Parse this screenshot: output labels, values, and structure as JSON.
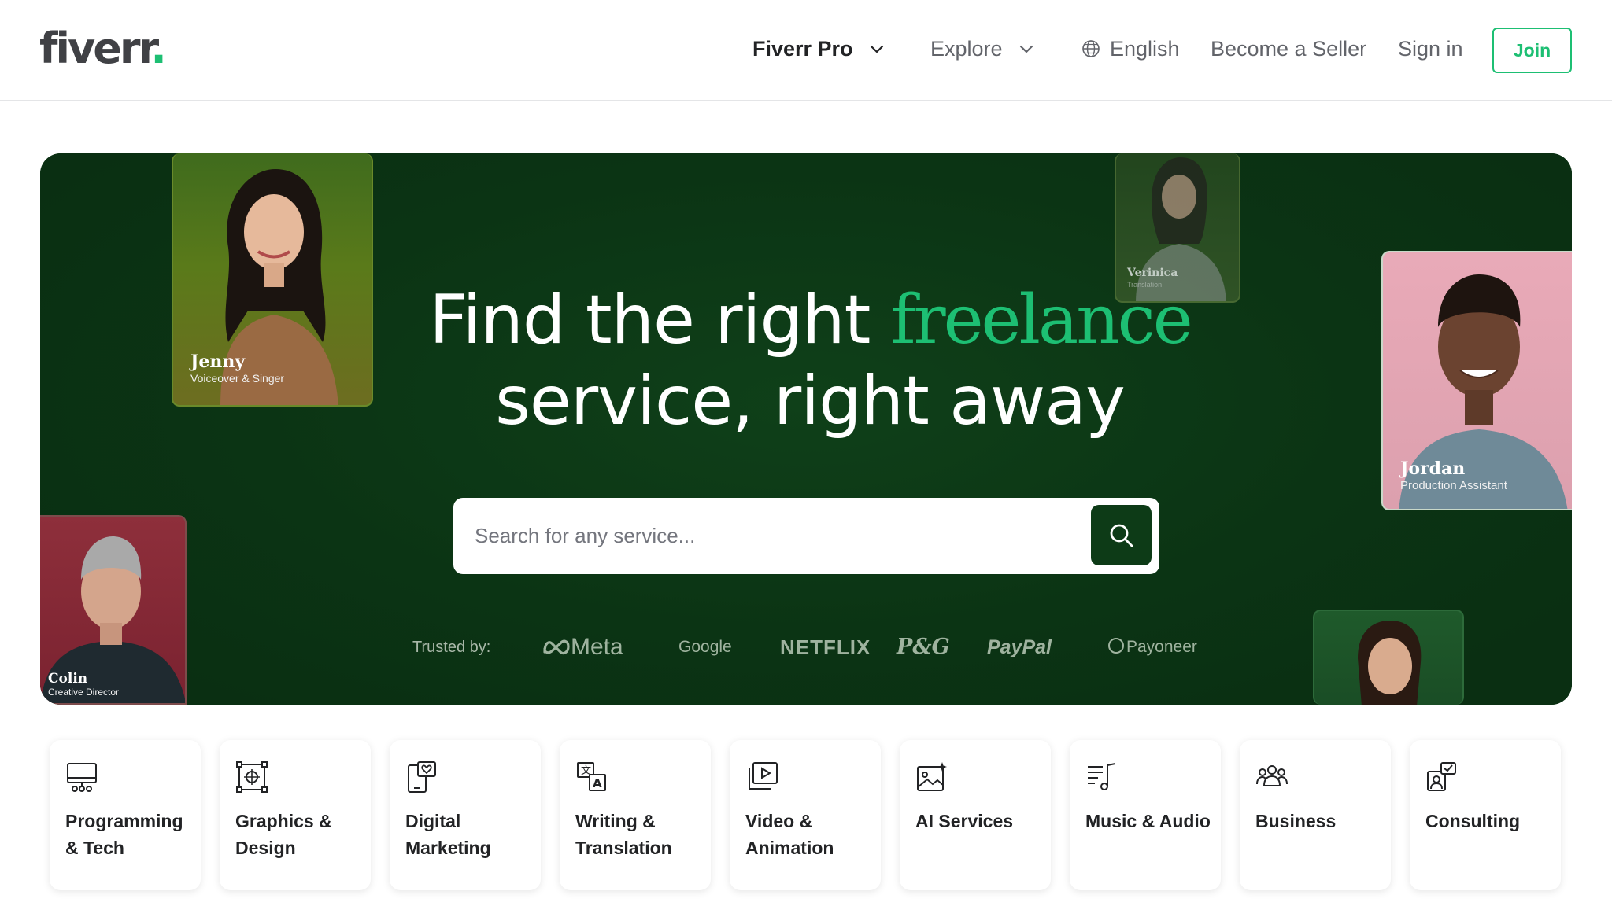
{
  "header": {
    "logo": {
      "text": "fiverr",
      "dot": "."
    },
    "nav": {
      "fiverr_pro": "Fiverr Pro",
      "explore": "Explore",
      "language": "English",
      "become_seller": "Become a Seller",
      "sign_in": "Sign in",
      "join": "Join"
    }
  },
  "hero": {
    "title_line1_pre": "Find the right ",
    "title_accent": "freelance",
    "title_line2": "service, right away",
    "search": {
      "placeholder": "Search for any service..."
    },
    "trusted_label": "Trusted by:",
    "brands": [
      "Meta",
      "Google",
      "NETFLIX",
      "P&G",
      "PayPal",
      "Payoneer"
    ],
    "cards": [
      {
        "name": "Jenny",
        "role": "Voiceover & Singer"
      },
      {
        "name": "Verinica",
        "role": "Translation"
      },
      {
        "name": "Jordan",
        "role": "Production Assistant"
      },
      {
        "name": "Colin",
        "role": "Creative Director"
      }
    ]
  },
  "categories": [
    {
      "label": "Programming & Tech",
      "icon": "monitor-code-icon"
    },
    {
      "label": "Graphics & Design",
      "icon": "design-frame-icon"
    },
    {
      "label": "Digital Marketing",
      "icon": "phone-heart-icon"
    },
    {
      "label": "Writing & Translation",
      "icon": "translate-icon"
    },
    {
      "label": "Video & Animation",
      "icon": "video-play-icon"
    },
    {
      "label": "AI Services",
      "icon": "ai-image-icon"
    },
    {
      "label": "Music & Audio",
      "icon": "music-note-icon"
    },
    {
      "label": "Business",
      "icon": "people-group-icon"
    },
    {
      "label": "Consulting",
      "icon": "consulting-chat-icon"
    }
  ],
  "colors": {
    "brand_green": "#1dbf73",
    "hero_bg": "#0d3b17",
    "text_dark": "#222325",
    "text_muted": "#62646a"
  }
}
